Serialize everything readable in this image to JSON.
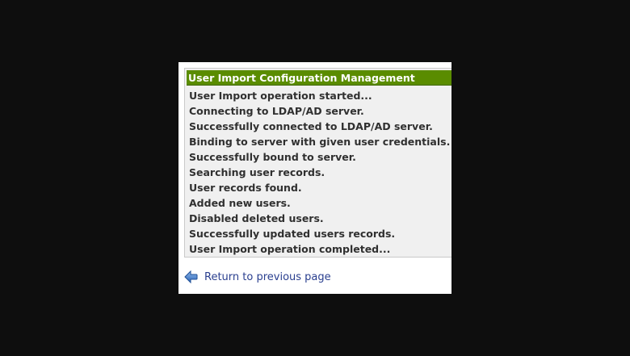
{
  "panel": {
    "title": "User Import Configuration Management",
    "header_color": "#5a8c00",
    "log_lines": [
      "User Import operation started...",
      "Connecting to LDAP/AD server.",
      "Successfully connected to LDAP/AD server.",
      "Binding to server with given user credentials.",
      "Successfully bound to server.",
      "Searching user records.",
      "User records found.",
      "Added new users.",
      "Disabled deleted users.",
      "Successfully updated users records.",
      "User Import operation completed..."
    ]
  },
  "footer": {
    "return_label": "Return to previous page",
    "return_icon": "back-arrow-icon"
  }
}
